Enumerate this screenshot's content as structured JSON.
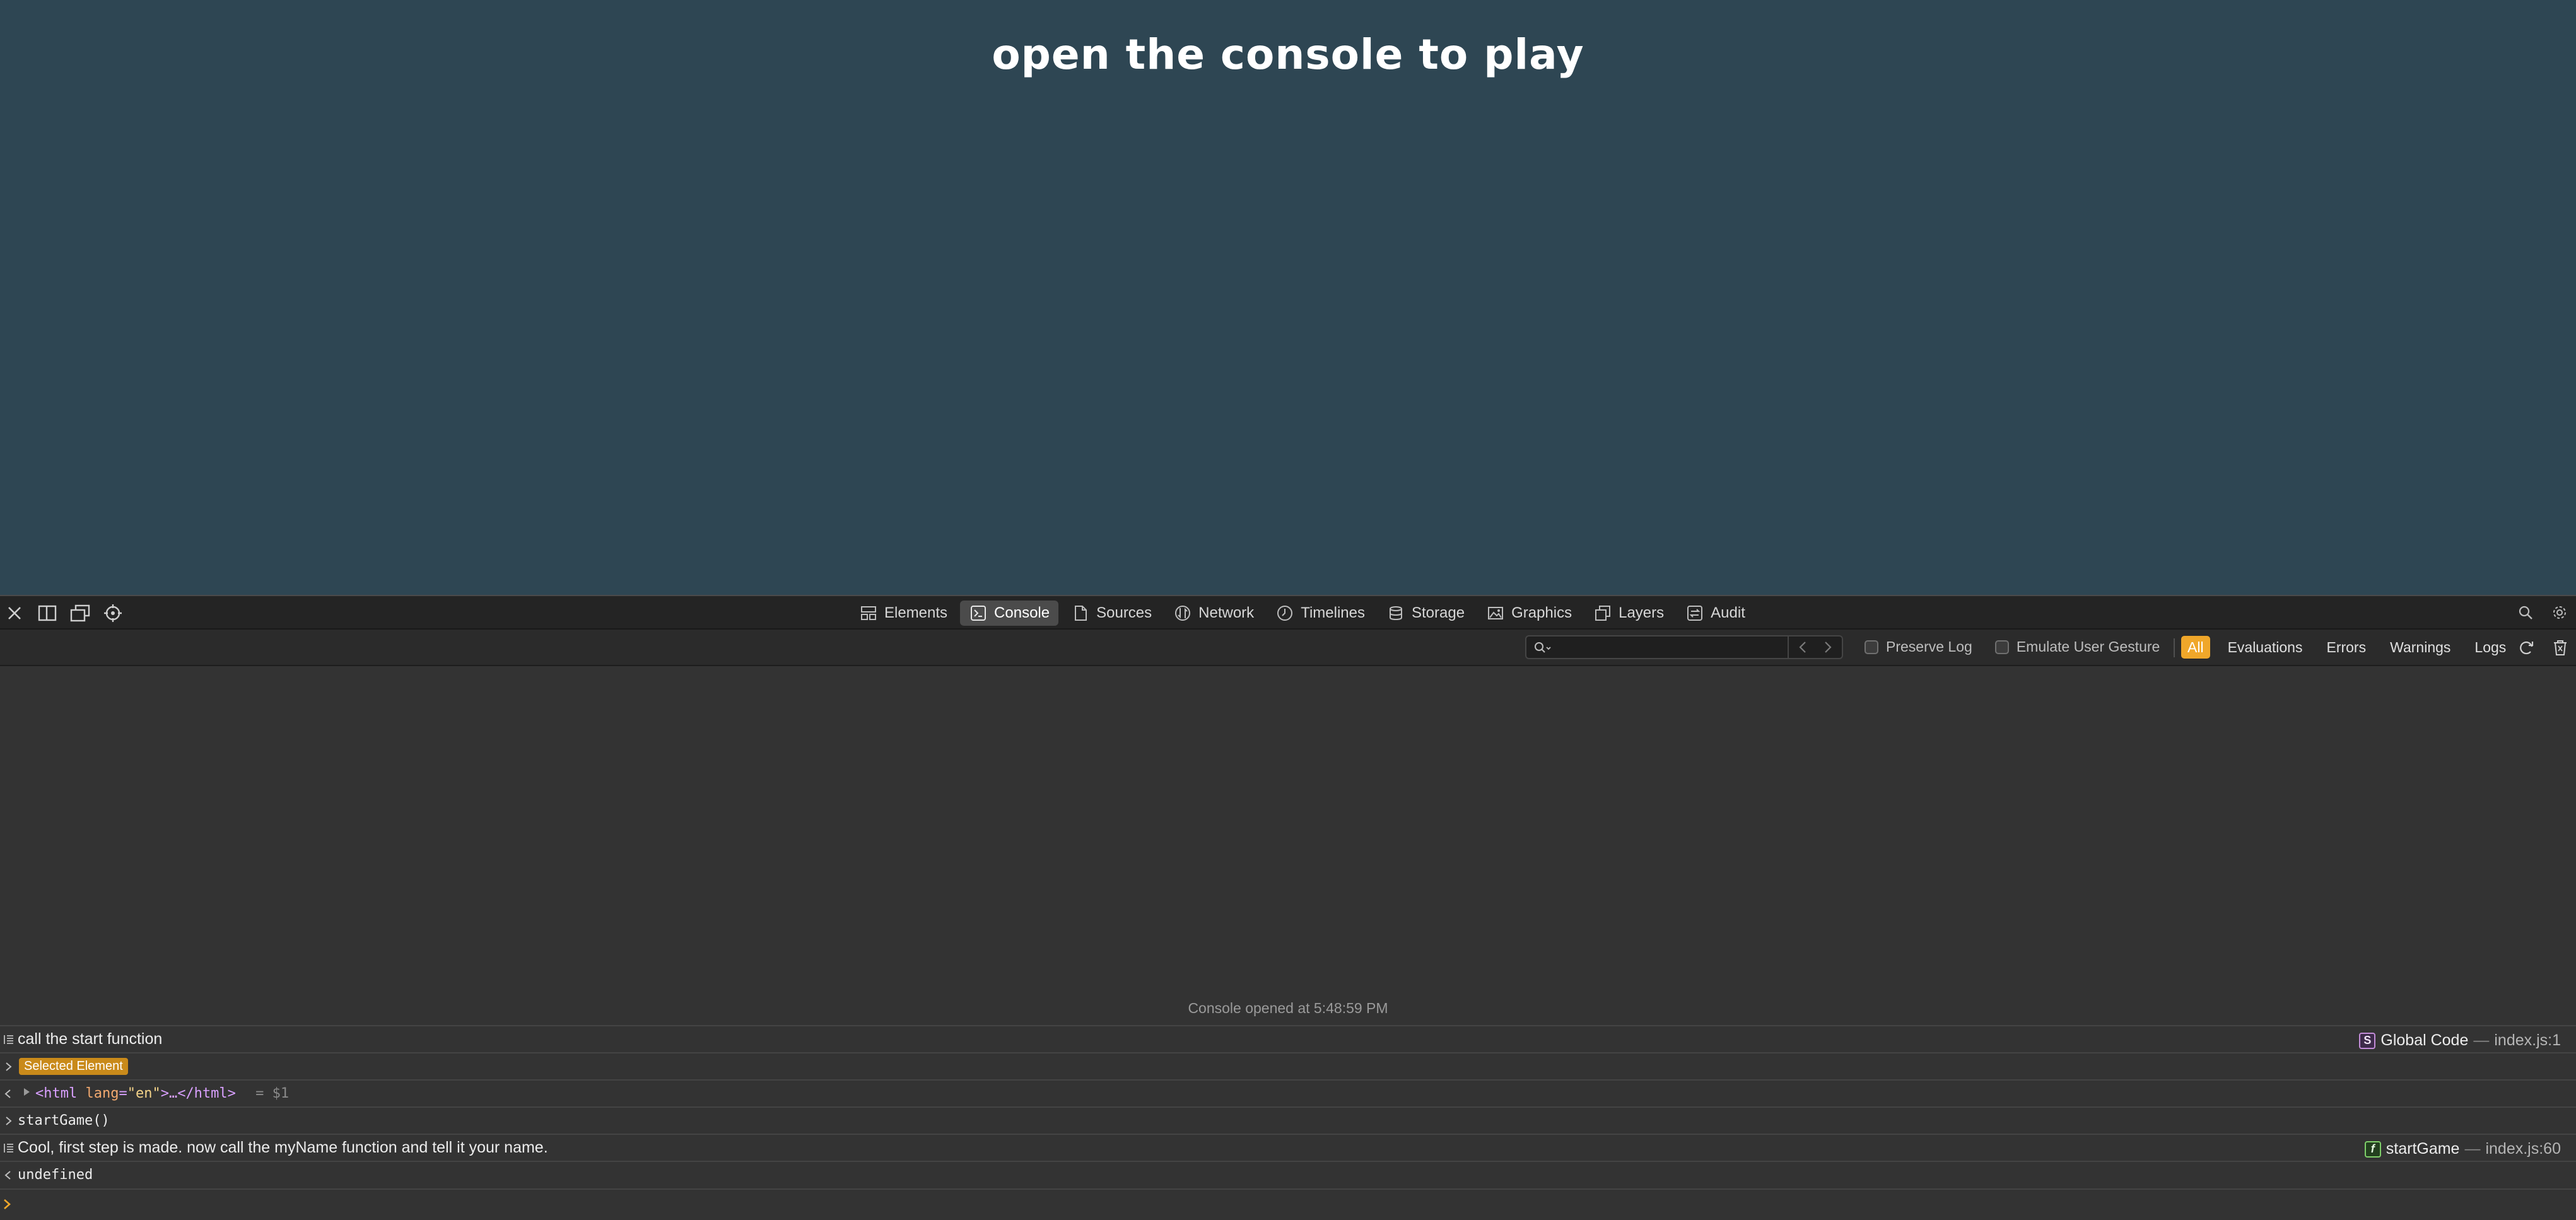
{
  "page": {
    "title": "open the console to play"
  },
  "devtools": {
    "tabs": [
      {
        "label": "Elements",
        "icon": "elements-icon",
        "active": false
      },
      {
        "label": "Console",
        "icon": "console-icon",
        "active": true
      },
      {
        "label": "Sources",
        "icon": "sources-icon",
        "active": false
      },
      {
        "label": "Network",
        "icon": "network-icon",
        "active": false
      },
      {
        "label": "Timelines",
        "icon": "timelines-icon",
        "active": false
      },
      {
        "label": "Storage",
        "icon": "storage-icon",
        "active": false
      },
      {
        "label": "Graphics",
        "icon": "graphics-icon",
        "active": false
      },
      {
        "label": "Layers",
        "icon": "layers-icon",
        "active": false
      },
      {
        "label": "Audit",
        "icon": "audit-icon",
        "active": false
      }
    ],
    "filter": {
      "search_placeholder": "",
      "preserve_log": "Preserve Log",
      "emulate_gesture": "Emulate User Gesture",
      "levels": [
        "All",
        "Evaluations",
        "Errors",
        "Warnings",
        "Logs"
      ],
      "active_level": "All"
    },
    "console": {
      "opened_message": "Console opened at 5:48:59 PM",
      "log1": {
        "text": "call the start function",
        "badge": "S",
        "source": "Global Code",
        "sep": "—",
        "location": "index.js:1"
      },
      "selected_element_badge": "Selected Element",
      "html_node": {
        "open": "<html",
        "attr": "lang",
        "eq": "=",
        "val": "\"en\"",
        "rest": ">…</html>",
        "ref": "= $1"
      },
      "command": "startGame()",
      "log2": {
        "text": "Cool, first step is made. now call the myName function and tell it your name.",
        "badge": "f",
        "source": "startGame",
        "sep": "—",
        "location": "index.js:60"
      },
      "result": "undefined",
      "prompt_value": ""
    },
    "colors": {
      "accent": "#f0a72a",
      "page_bg": "#2e4653",
      "console_bg": "#333333"
    }
  }
}
